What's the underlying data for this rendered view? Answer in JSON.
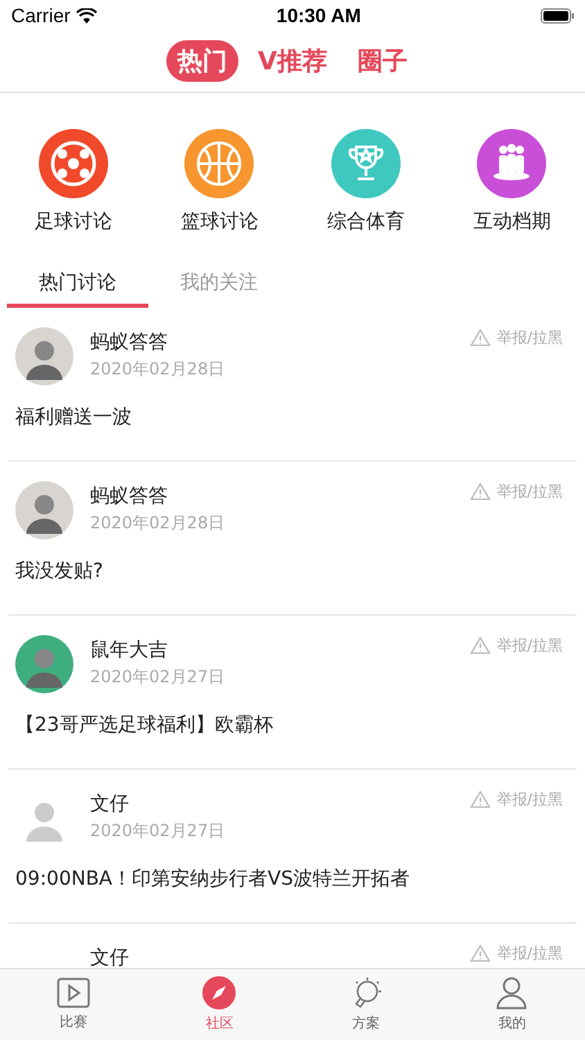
{
  "status_bar": {
    "carrier": "Carrier",
    "time": "10:30 AM"
  },
  "top_tabs": [
    {
      "label": "热门",
      "selected": true
    },
    {
      "label": "V推荐",
      "selected": false
    },
    {
      "label": "圈子",
      "selected": false
    }
  ],
  "categories": [
    {
      "label": "足球讨论",
      "kind": "football",
      "color": "#f04a2a"
    },
    {
      "label": "篮球讨论",
      "kind": "basketball",
      "color": "#f7962e"
    },
    {
      "label": "综合体育",
      "kind": "trophy",
      "color": "#3ec8c0"
    },
    {
      "label": "互动档期",
      "kind": "people",
      "color": "#c94fd9"
    }
  ],
  "sub_tabs": [
    {
      "label": "热门讨论",
      "selected": true
    },
    {
      "label": "我的关注",
      "selected": false
    }
  ],
  "posts": [
    {
      "author": "蚂蚁答答",
      "date": "2020年02月28日",
      "report": "举报/拉黑",
      "content": "福利赠送一波",
      "kind": "photo"
    },
    {
      "author": "蚂蚁答答",
      "date": "2020年02月28日",
      "report": "举报/拉黑",
      "content": "我没发贴?",
      "kind": "photo"
    },
    {
      "author": "鼠年大吉",
      "date": "2020年02月27日",
      "report": "举报/拉黑",
      "content": "【23哥严选足球福利】欧霸杯",
      "kind": "cartoon"
    },
    {
      "author": "文仔",
      "date": "2020年02月27日",
      "report": "举报/拉黑",
      "content": "09:00NBA！印第安纳步行者VS波特兰开拓者",
      "kind": "sketch"
    },
    {
      "author": "文仔",
      "report": "举报/拉黑",
      "kind": "cut"
    }
  ],
  "tab_bar": [
    {
      "label": "比赛",
      "kind": "play",
      "selected": false
    },
    {
      "label": "社区",
      "kind": "compass",
      "selected": true
    },
    {
      "label": "方案",
      "kind": "bulb",
      "selected": false
    },
    {
      "label": "我的",
      "kind": "person",
      "selected": false
    }
  ]
}
